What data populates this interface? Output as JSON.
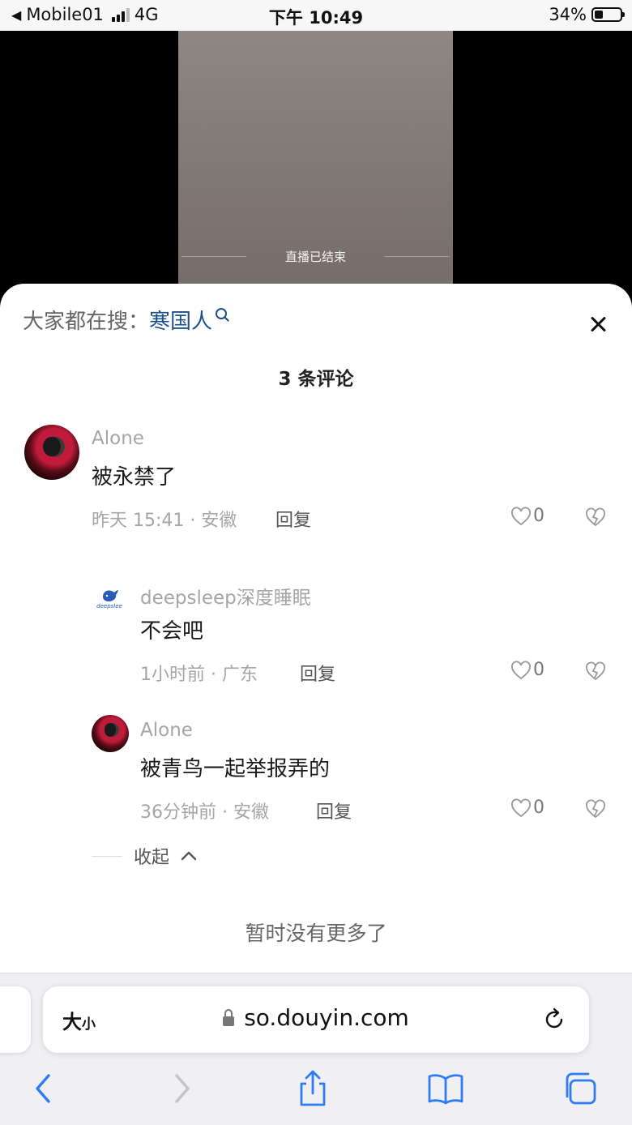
{
  "status_bar": {
    "back_app": "Mobile01",
    "network": "4G",
    "time": "下午 10:49",
    "battery": "34%",
    "battery_level": 0.34
  },
  "video": {
    "live_ended": "直播已结束"
  },
  "comments_panel": {
    "search_prefix": "大家都在搜：",
    "search_term": "寒国人",
    "count_label": "3 条评论",
    "collapse_label": "收起",
    "no_more": "暂时没有更多了",
    "comments": [
      {
        "username": "Alone",
        "text": "被永禁了",
        "time": "昨天 15:41",
        "location": "安徽",
        "reply": "回复",
        "likes": "0"
      },
      {
        "username": "deepsleep深度睡眠",
        "avatar_text": "deepslee",
        "text": "不会吧",
        "time": "1小时前",
        "location": "广东",
        "reply": "回复",
        "likes": "0"
      },
      {
        "username": "Alone",
        "text": "被青鸟一起举报弄的",
        "time": "36分钟前",
        "location": "安徽",
        "reply": "回复",
        "likes": "0"
      }
    ]
  },
  "safari": {
    "text_size_big": "大",
    "text_size_small": "小",
    "url": "so.douyin.com",
    "accent": "#2f7bf5"
  }
}
